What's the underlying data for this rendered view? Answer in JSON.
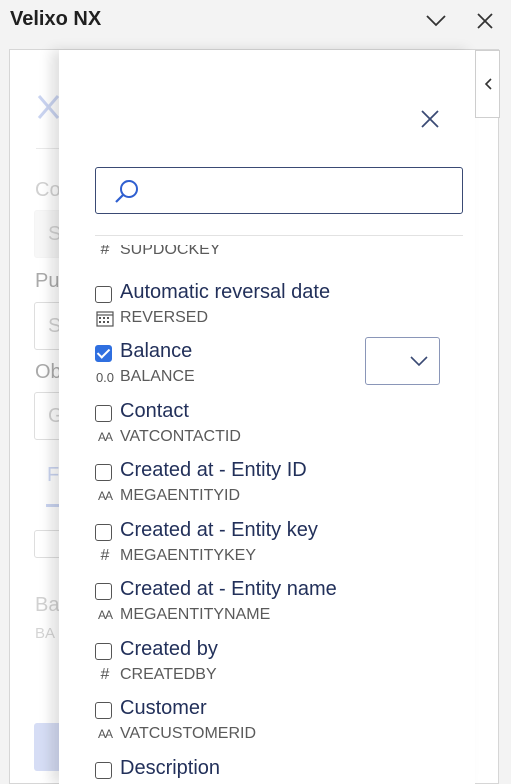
{
  "window": {
    "title": "Velixo NX"
  },
  "background": {
    "label_1": "Co",
    "field_1": "S",
    "label_2": "Pu",
    "field_2": "S",
    "label_3": "Ob",
    "field_3": "G",
    "tab_1": "F",
    "section_title": "Ba",
    "section_sub": "BA"
  },
  "flyout": {
    "search": {
      "value": "",
      "placeholder": ""
    },
    "fields": [
      {
        "label": "",
        "key": "SUPDOCKEY",
        "type_icon": "#",
        "type": "number",
        "checked": false
      },
      {
        "label": "Automatic reversal date",
        "key": "REVERSED",
        "type_icon": "calendar-icon",
        "type": "date",
        "checked": false
      },
      {
        "label": "Balance",
        "key": "BALANCE",
        "type_icon": "0.0",
        "type": "decimal",
        "checked": true
      },
      {
        "label": "Contact",
        "key": "VATCONTACTID",
        "type_icon": "AA",
        "type": "text",
        "checked": false
      },
      {
        "label": "Created at - Entity ID",
        "key": "MEGAENTITYID",
        "type_icon": "AA",
        "type": "text",
        "checked": false
      },
      {
        "label": "Created at - Entity key",
        "key": "MEGAENTITYKEY",
        "type_icon": "#",
        "type": "number",
        "checked": false
      },
      {
        "label": "Created at - Entity name",
        "key": "MEGAENTITYNAME",
        "type_icon": "AA",
        "type": "text",
        "checked": false
      },
      {
        "label": "Created by",
        "key": "CREATEDBY",
        "type_icon": "#",
        "type": "number",
        "checked": false
      },
      {
        "label": "Customer",
        "key": "VATCUSTOMERID",
        "type_icon": "AA",
        "type": "text",
        "checked": false
      },
      {
        "label": "Description",
        "key": "",
        "type_icon": "",
        "type": "text",
        "checked": false
      }
    ]
  },
  "icons": {
    "close": "close-icon",
    "chevron_down": "chevron-down-icon",
    "chevron_left": "chevron-left-icon",
    "search": "search-icon",
    "calendar": "calendar-icon"
  },
  "colors": {
    "accent": "#2f6fe0",
    "label_text": "#22305a",
    "search_border": "#3a4a74"
  }
}
